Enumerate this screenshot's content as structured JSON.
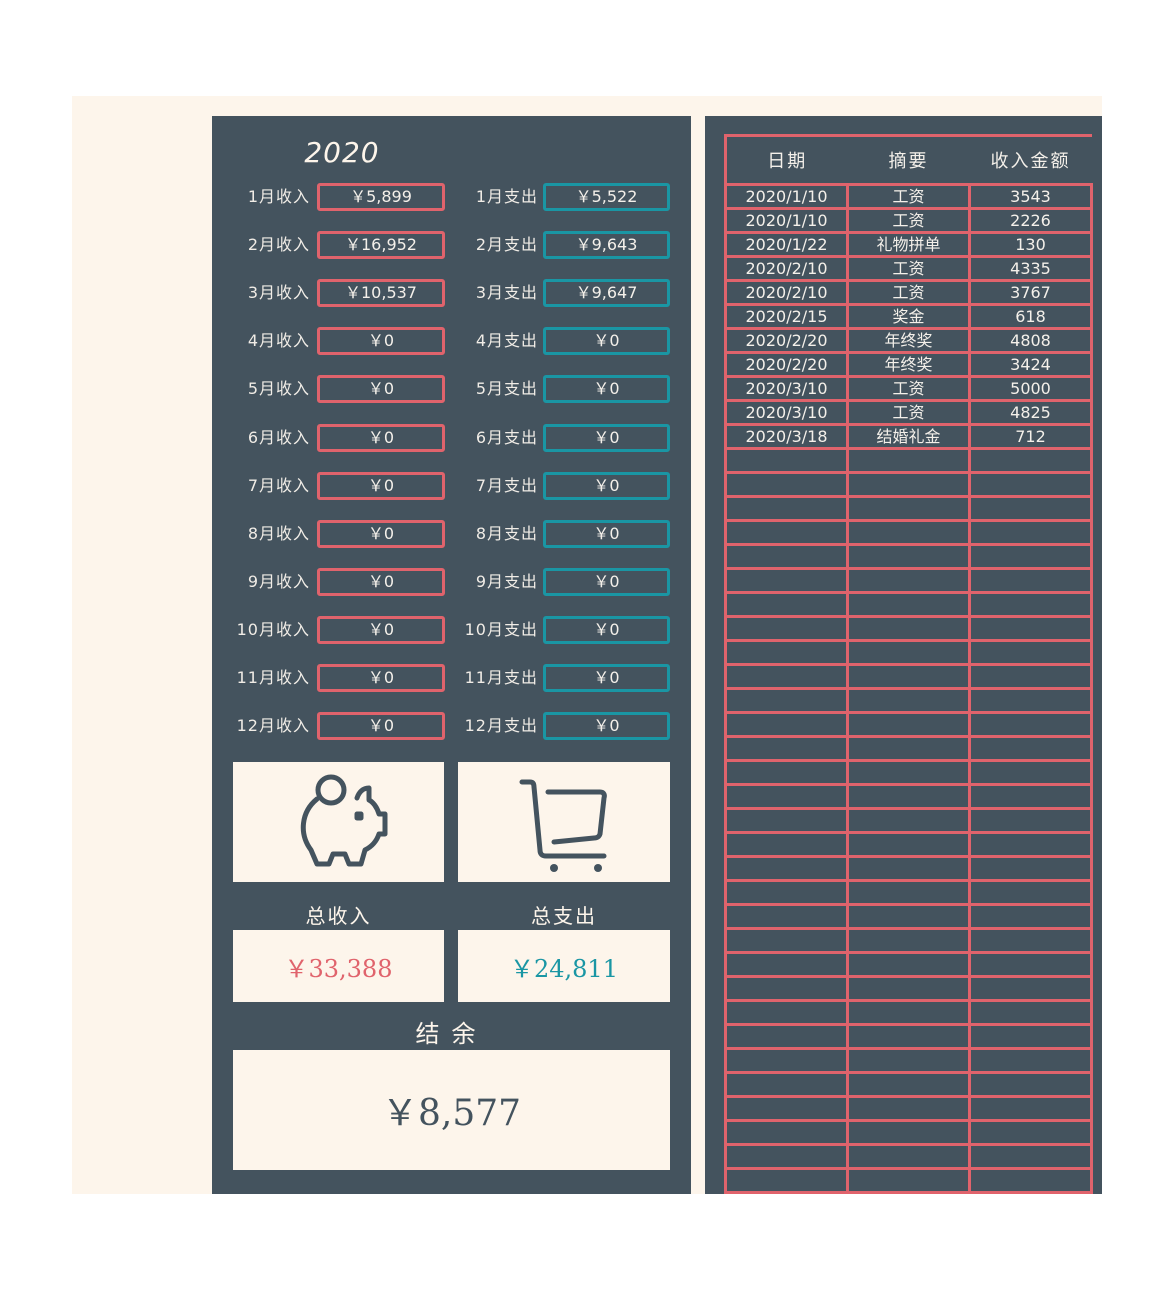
{
  "dashboard": {
    "year": "2020",
    "months": [
      {
        "income_label": "1月收入",
        "income": "￥5,899",
        "expense_label": "1月支出",
        "expense": "￥5,522"
      },
      {
        "income_label": "2月收入",
        "income": "￥16,952",
        "expense_label": "2月支出",
        "expense": "￥9,643"
      },
      {
        "income_label": "3月收入",
        "income": "￥10,537",
        "expense_label": "3月支出",
        "expense": "￥9,647"
      },
      {
        "income_label": "4月收入",
        "income": "￥0",
        "expense_label": "4月支出",
        "expense": "￥0"
      },
      {
        "income_label": "5月收入",
        "income": "￥0",
        "expense_label": "5月支出",
        "expense": "￥0"
      },
      {
        "income_label": "6月收入",
        "income": "￥0",
        "expense_label": "6月支出",
        "expense": "￥0"
      },
      {
        "income_label": "7月收入",
        "income": "￥0",
        "expense_label": "7月支出",
        "expense": "￥0"
      },
      {
        "income_label": "8月收入",
        "income": "￥0",
        "expense_label": "8月支出",
        "expense": "￥0"
      },
      {
        "income_label": "9月收入",
        "income": "￥0",
        "expense_label": "9月支出",
        "expense": "￥0"
      },
      {
        "income_label": "10月收入",
        "income": "￥0",
        "expense_label": "10月支出",
        "expense": "￥0"
      },
      {
        "income_label": "11月收入",
        "income": "￥0",
        "expense_label": "11月支出",
        "expense": "￥0"
      },
      {
        "income_label": "12月收入",
        "income": "￥0",
        "expense_label": "12月支出",
        "expense": "￥0"
      }
    ],
    "icons": {
      "income": "piggy-bank-icon",
      "expense": "shopping-cart-icon"
    },
    "total_income_label": "总收入",
    "total_income": "￥33,388",
    "total_expense_label": "总支出",
    "total_expense": "￥24,811",
    "balance_label": "结余",
    "balance": "￥8,577"
  },
  "income_table": {
    "headers": [
      "日期",
      "摘要",
      "收入金额"
    ],
    "rows": [
      [
        "2020/1/10",
        "工资",
        "3543"
      ],
      [
        "2020/1/10",
        "工资",
        "2226"
      ],
      [
        "2020/1/22",
        "礼物拼单",
        "130"
      ],
      [
        "2020/2/10",
        "工资",
        "4335"
      ],
      [
        "2020/2/10",
        "工资",
        "3767"
      ],
      [
        "2020/2/15",
        "奖金",
        "618"
      ],
      [
        "2020/2/20",
        "年终奖",
        "4808"
      ],
      [
        "2020/2/20",
        "年终奖",
        "3424"
      ],
      [
        "2020/3/10",
        "工资",
        "5000"
      ],
      [
        "2020/3/10",
        "工资",
        "4825"
      ],
      [
        "2020/3/18",
        "结婚礼金",
        "712"
      ]
    ],
    "empty_rows": 31
  },
  "colors": {
    "panel": "#44535e",
    "cream": "#fdf5eb",
    "income_accent": "#e0636c",
    "expense_accent": "#1a96a4"
  }
}
